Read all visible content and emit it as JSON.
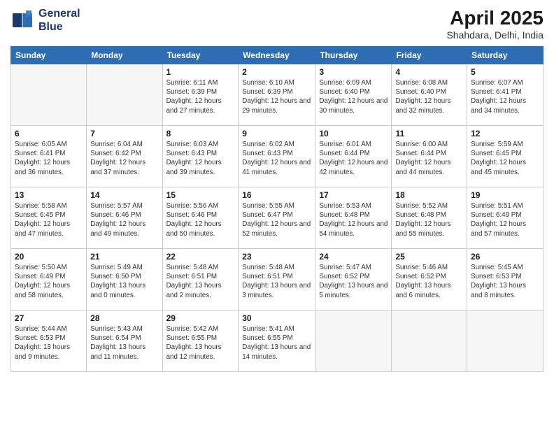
{
  "logo": {
    "line1": "General",
    "line2": "Blue"
  },
  "title": "April 2025",
  "subtitle": "Shahdara, Delhi, India",
  "headers": [
    "Sunday",
    "Monday",
    "Tuesday",
    "Wednesday",
    "Thursday",
    "Friday",
    "Saturday"
  ],
  "weeks": [
    [
      {
        "day": "",
        "detail": ""
      },
      {
        "day": "",
        "detail": ""
      },
      {
        "day": "1",
        "detail": "Sunrise: 6:11 AM\nSunset: 6:39 PM\nDaylight: 12 hours and 27 minutes."
      },
      {
        "day": "2",
        "detail": "Sunrise: 6:10 AM\nSunset: 6:39 PM\nDaylight: 12 hours and 29 minutes."
      },
      {
        "day": "3",
        "detail": "Sunrise: 6:09 AM\nSunset: 6:40 PM\nDaylight: 12 hours and 30 minutes."
      },
      {
        "day": "4",
        "detail": "Sunrise: 6:08 AM\nSunset: 6:40 PM\nDaylight: 12 hours and 32 minutes."
      },
      {
        "day": "5",
        "detail": "Sunrise: 6:07 AM\nSunset: 6:41 PM\nDaylight: 12 hours and 34 minutes."
      }
    ],
    [
      {
        "day": "6",
        "detail": "Sunrise: 6:05 AM\nSunset: 6:41 PM\nDaylight: 12 hours and 36 minutes."
      },
      {
        "day": "7",
        "detail": "Sunrise: 6:04 AM\nSunset: 6:42 PM\nDaylight: 12 hours and 37 minutes."
      },
      {
        "day": "8",
        "detail": "Sunrise: 6:03 AM\nSunset: 6:43 PM\nDaylight: 12 hours and 39 minutes."
      },
      {
        "day": "9",
        "detail": "Sunrise: 6:02 AM\nSunset: 6:43 PM\nDaylight: 12 hours and 41 minutes."
      },
      {
        "day": "10",
        "detail": "Sunrise: 6:01 AM\nSunset: 6:44 PM\nDaylight: 12 hours and 42 minutes."
      },
      {
        "day": "11",
        "detail": "Sunrise: 6:00 AM\nSunset: 6:44 PM\nDaylight: 12 hours and 44 minutes."
      },
      {
        "day": "12",
        "detail": "Sunrise: 5:59 AM\nSunset: 6:45 PM\nDaylight: 12 hours and 45 minutes."
      }
    ],
    [
      {
        "day": "13",
        "detail": "Sunrise: 5:58 AM\nSunset: 6:45 PM\nDaylight: 12 hours and 47 minutes."
      },
      {
        "day": "14",
        "detail": "Sunrise: 5:57 AM\nSunset: 6:46 PM\nDaylight: 12 hours and 49 minutes."
      },
      {
        "day": "15",
        "detail": "Sunrise: 5:56 AM\nSunset: 6:46 PM\nDaylight: 12 hours and 50 minutes."
      },
      {
        "day": "16",
        "detail": "Sunrise: 5:55 AM\nSunset: 6:47 PM\nDaylight: 12 hours and 52 minutes."
      },
      {
        "day": "17",
        "detail": "Sunrise: 5:53 AM\nSunset: 6:48 PM\nDaylight: 12 hours and 54 minutes."
      },
      {
        "day": "18",
        "detail": "Sunrise: 5:52 AM\nSunset: 6:48 PM\nDaylight: 12 hours and 55 minutes."
      },
      {
        "day": "19",
        "detail": "Sunrise: 5:51 AM\nSunset: 6:49 PM\nDaylight: 12 hours and 57 minutes."
      }
    ],
    [
      {
        "day": "20",
        "detail": "Sunrise: 5:50 AM\nSunset: 6:49 PM\nDaylight: 12 hours and 58 minutes."
      },
      {
        "day": "21",
        "detail": "Sunrise: 5:49 AM\nSunset: 6:50 PM\nDaylight: 13 hours and 0 minutes."
      },
      {
        "day": "22",
        "detail": "Sunrise: 5:48 AM\nSunset: 6:51 PM\nDaylight: 13 hours and 2 minutes."
      },
      {
        "day": "23",
        "detail": "Sunrise: 5:48 AM\nSunset: 6:51 PM\nDaylight: 13 hours and 3 minutes."
      },
      {
        "day": "24",
        "detail": "Sunrise: 5:47 AM\nSunset: 6:52 PM\nDaylight: 13 hours and 5 minutes."
      },
      {
        "day": "25",
        "detail": "Sunrise: 5:46 AM\nSunset: 6:52 PM\nDaylight: 13 hours and 6 minutes."
      },
      {
        "day": "26",
        "detail": "Sunrise: 5:45 AM\nSunset: 6:53 PM\nDaylight: 13 hours and 8 minutes."
      }
    ],
    [
      {
        "day": "27",
        "detail": "Sunrise: 5:44 AM\nSunset: 6:53 PM\nDaylight: 13 hours and 9 minutes."
      },
      {
        "day": "28",
        "detail": "Sunrise: 5:43 AM\nSunset: 6:54 PM\nDaylight: 13 hours and 11 minutes."
      },
      {
        "day": "29",
        "detail": "Sunrise: 5:42 AM\nSunset: 6:55 PM\nDaylight: 13 hours and 12 minutes."
      },
      {
        "day": "30",
        "detail": "Sunrise: 5:41 AM\nSunset: 6:55 PM\nDaylight: 13 hours and 14 minutes."
      },
      {
        "day": "",
        "detail": ""
      },
      {
        "day": "",
        "detail": ""
      },
      {
        "day": "",
        "detail": ""
      }
    ]
  ]
}
